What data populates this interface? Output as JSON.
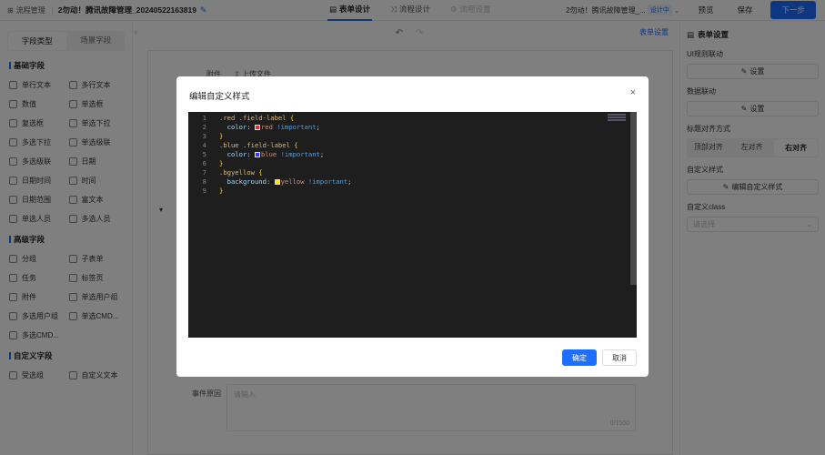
{
  "topbar": {
    "home_label": "流程管理",
    "separator": "|",
    "app_title": "2勿动！腾讯故障管理_20240522163819",
    "tabs": [
      {
        "label": "表单设计",
        "active": true
      },
      {
        "label": "流程设计",
        "active": false
      },
      {
        "label": "流程设置",
        "active": false,
        "disabled": true
      }
    ],
    "project_name": "2勿动！腾讯故障管理_...",
    "project_badge": "设计中",
    "preview_label": "预览",
    "save_label": "保存",
    "next_label": "下一步"
  },
  "left_panel": {
    "tabs": [
      "字段类型",
      "场景字段"
    ],
    "sections": [
      {
        "title": "基础字段",
        "items": [
          "单行文本",
          "多行文本",
          "数值",
          "单选框",
          "复选框",
          "单选下拉",
          "多选下拉",
          "单选级联",
          "多选级联",
          "日期",
          "日期时间",
          "时间",
          "日期范围",
          "富文本",
          "单选人员",
          "多选人员"
        ]
      },
      {
        "title": "高级字段",
        "items": [
          "分组",
          "子表单",
          "任务",
          "标签页",
          "附件",
          "单选用户组",
          "多选用户组",
          "单选CMD...",
          "多选CMD..."
        ]
      },
      {
        "title": "自定义字段",
        "items": [
          "受选组",
          "自定义文本"
        ]
      }
    ]
  },
  "canvas": {
    "form_settings_link": "表单设置",
    "attach_label": "附件",
    "upload_label": "上传文件",
    "reason_label": "事件原因",
    "reason_placeholder": "请输入",
    "reason_count": "0/1500"
  },
  "right_panel": {
    "title": "表单设置",
    "ui_rule_label": "UI规则联动",
    "ui_rule_button": "设置",
    "data_link_label": "数据联动",
    "data_link_button": "设置",
    "title_align_label": "标题对齐方式",
    "align_options": [
      {
        "label": "顶部对齐",
        "active": false
      },
      {
        "label": "左对齐",
        "active": false
      },
      {
        "label": "右对齐",
        "active": true
      }
    ],
    "custom_style_label": "自定义样式",
    "custom_style_button": "编辑自定义样式",
    "custom_class_label": "自定义class",
    "custom_class_placeholder": "请选择"
  },
  "modal": {
    "title": "编辑自定义样式",
    "confirm_label": "确定",
    "cancel_label": "取消",
    "code_lines": [
      ".red .field-label {",
      "  color: red !important;",
      "}",
      ".blue .field-label {",
      "  color: blue !important;",
      "}",
      ".bgyellow {",
      "  background: yellow !important;",
      "}"
    ],
    "colors": {
      "red": "#e03030",
      "blue": "#2a3cff",
      "yellow": "#ffe100"
    }
  },
  "colors": {
    "primary": "#1e6fff",
    "overlay": "rgba(0,0,0,0.5)",
    "editor_bg": "#1e1e1e"
  }
}
